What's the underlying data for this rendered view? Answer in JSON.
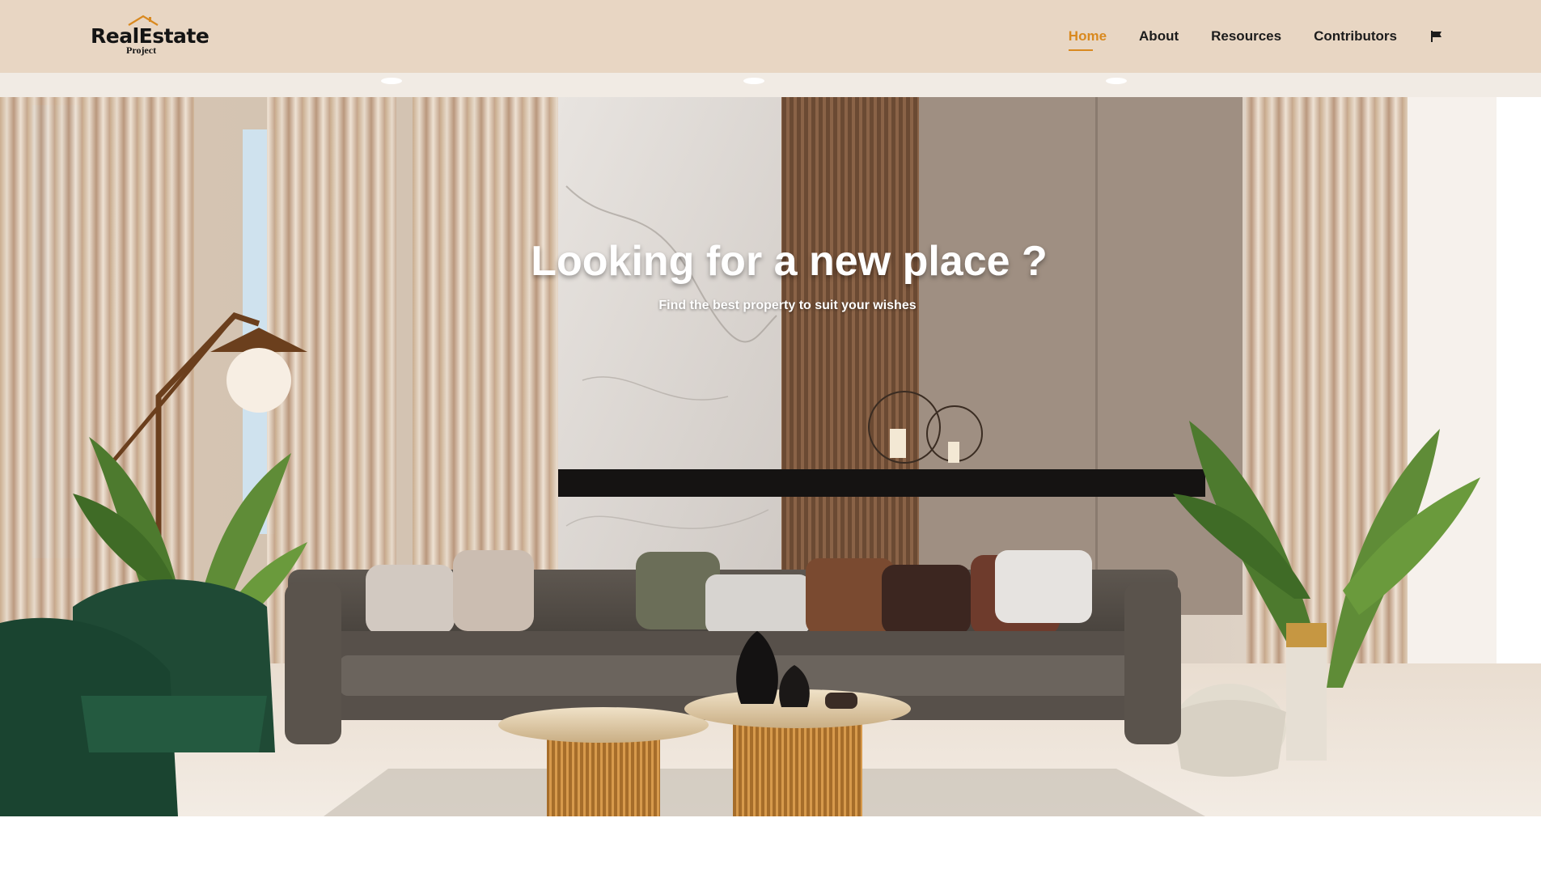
{
  "brand": {
    "name": "RealEstate",
    "tagline": "Project"
  },
  "nav": {
    "items": [
      {
        "label": "Home",
        "active": true
      },
      {
        "label": "About",
        "active": false
      },
      {
        "label": "Resources",
        "active": false
      },
      {
        "label": "Contributors",
        "active": false
      }
    ],
    "language_icon": "flag-icon"
  },
  "hero": {
    "title": "Looking for a new place ?",
    "subtitle": "Find the best property to suit your wishes",
    "background": "living-room-photo"
  },
  "colors": {
    "header_bg": "#e8d6c3",
    "accent": "#d9891f",
    "nav_text": "#1c1c1c",
    "hero_text": "#ffffff"
  }
}
